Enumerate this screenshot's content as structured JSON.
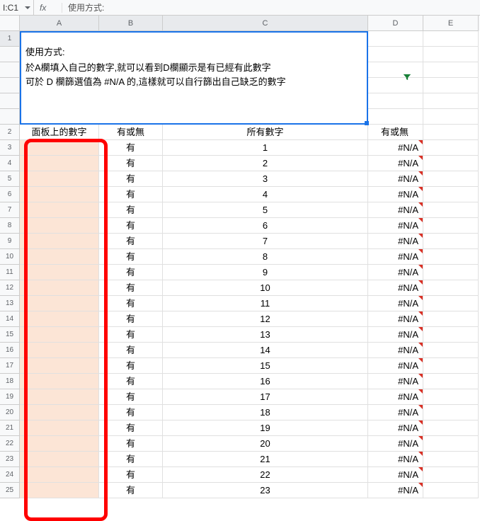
{
  "formula_bar": {
    "name_box": "I:C1",
    "fx": "fx",
    "hint": "使用方式:"
  },
  "columns": [
    "A",
    "B",
    "C",
    "D",
    "E"
  ],
  "merged_cell": {
    "line1": "使用方式:",
    "line2": "於A欄填入自己的數字,就可以看到D欄顯示是有已經有此數字",
    "line3": "可於 D 欄篩選值為 #N/A 的,這樣就可以自行篩出自己缺乏的數字"
  },
  "headers": {
    "a": "面板上的數字",
    "b": "有或無",
    "c": "所有數字",
    "d": "有或無"
  },
  "row_labels_top": [
    "1"
  ],
  "data_rows": [
    {
      "n": "3",
      "b": "有",
      "c": "1",
      "d": "#N/A"
    },
    {
      "n": "4",
      "b": "有",
      "c": "2",
      "d": "#N/A"
    },
    {
      "n": "5",
      "b": "有",
      "c": "3",
      "d": "#N/A"
    },
    {
      "n": "6",
      "b": "有",
      "c": "4",
      "d": "#N/A"
    },
    {
      "n": "7",
      "b": "有",
      "c": "5",
      "d": "#N/A"
    },
    {
      "n": "8",
      "b": "有",
      "c": "6",
      "d": "#N/A"
    },
    {
      "n": "9",
      "b": "有",
      "c": "7",
      "d": "#N/A"
    },
    {
      "n": "10",
      "b": "有",
      "c": "8",
      "d": "#N/A"
    },
    {
      "n": "11",
      "b": "有",
      "c": "9",
      "d": "#N/A"
    },
    {
      "n": "12",
      "b": "有",
      "c": "10",
      "d": "#N/A"
    },
    {
      "n": "13",
      "b": "有",
      "c": "11",
      "d": "#N/A"
    },
    {
      "n": "14",
      "b": "有",
      "c": "12",
      "d": "#N/A"
    },
    {
      "n": "15",
      "b": "有",
      "c": "13",
      "d": "#N/A"
    },
    {
      "n": "16",
      "b": "有",
      "c": "14",
      "d": "#N/A"
    },
    {
      "n": "17",
      "b": "有",
      "c": "15",
      "d": "#N/A"
    },
    {
      "n": "18",
      "b": "有",
      "c": "16",
      "d": "#N/A"
    },
    {
      "n": "19",
      "b": "有",
      "c": "17",
      "d": "#N/A"
    },
    {
      "n": "20",
      "b": "有",
      "c": "18",
      "d": "#N/A"
    },
    {
      "n": "21",
      "b": "有",
      "c": "19",
      "d": "#N/A"
    },
    {
      "n": "22",
      "b": "有",
      "c": "20",
      "d": "#N/A"
    },
    {
      "n": "23",
      "b": "有",
      "c": "21",
      "d": "#N/A"
    },
    {
      "n": "24",
      "b": "有",
      "c": "22",
      "d": "#N/A"
    },
    {
      "n": "25",
      "b": "有",
      "c": "23",
      "d": "#N/A"
    }
  ],
  "header_row_num": "2"
}
